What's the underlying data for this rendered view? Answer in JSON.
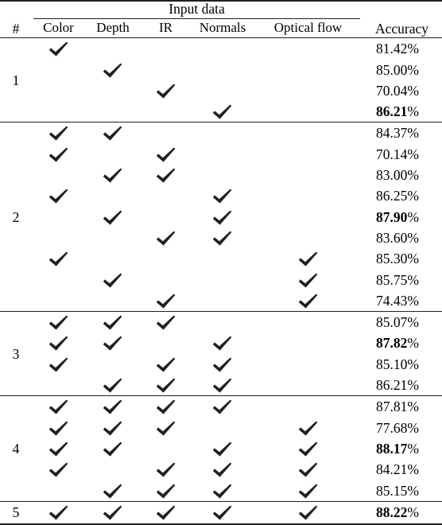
{
  "table": {
    "columns": {
      "number_header": "#",
      "group_header": "Input data",
      "accuracy_header": "Accuracy",
      "inputs": [
        "Color",
        "Depth",
        "IR",
        "Normals",
        "Optical flow"
      ]
    },
    "check_icon": "checkmark-icon",
    "percent_symbol": "%",
    "groups": [
      {
        "number": "1",
        "rows": [
          {
            "checks": [
              true,
              false,
              false,
              false,
              false
            ],
            "accuracy": "81.42",
            "bold": false
          },
          {
            "checks": [
              false,
              true,
              false,
              false,
              false
            ],
            "accuracy": "85.00",
            "bold": false
          },
          {
            "checks": [
              false,
              false,
              true,
              false,
              false
            ],
            "accuracy": "70.04",
            "bold": false
          },
          {
            "checks": [
              false,
              false,
              false,
              true,
              false
            ],
            "accuracy": "86.21",
            "bold": true
          }
        ]
      },
      {
        "number": "2",
        "rows": [
          {
            "checks": [
              true,
              true,
              false,
              false,
              false
            ],
            "accuracy": "84.37",
            "bold": false
          },
          {
            "checks": [
              true,
              false,
              true,
              false,
              false
            ],
            "accuracy": "70.14",
            "bold": false
          },
          {
            "checks": [
              false,
              true,
              true,
              false,
              false
            ],
            "accuracy": "83.00",
            "bold": false
          },
          {
            "checks": [
              true,
              false,
              false,
              true,
              false
            ],
            "accuracy": "86.25",
            "bold": false
          },
          {
            "checks": [
              false,
              true,
              false,
              true,
              false
            ],
            "accuracy": "87.90",
            "bold": true
          },
          {
            "checks": [
              false,
              false,
              true,
              true,
              false
            ],
            "accuracy": "83.60",
            "bold": false
          },
          {
            "checks": [
              true,
              false,
              false,
              false,
              true
            ],
            "accuracy": "85.30",
            "bold": false
          },
          {
            "checks": [
              false,
              true,
              false,
              false,
              true
            ],
            "accuracy": "85.75",
            "bold": false
          },
          {
            "checks": [
              false,
              false,
              true,
              false,
              true
            ],
            "accuracy": "74.43",
            "bold": false
          }
        ]
      },
      {
        "number": "3",
        "rows": [
          {
            "checks": [
              true,
              true,
              true,
              false,
              false
            ],
            "accuracy": "85.07",
            "bold": false
          },
          {
            "checks": [
              true,
              true,
              false,
              true,
              false
            ],
            "accuracy": "87.82",
            "bold": true
          },
          {
            "checks": [
              true,
              false,
              true,
              true,
              false
            ],
            "accuracy": "85.10",
            "bold": false
          },
          {
            "checks": [
              false,
              true,
              true,
              true,
              false
            ],
            "accuracy": "86.21",
            "bold": false
          }
        ]
      },
      {
        "number": "4",
        "rows": [
          {
            "checks": [
              true,
              true,
              true,
              true,
              false
            ],
            "accuracy": "87.81",
            "bold": false
          },
          {
            "checks": [
              true,
              true,
              true,
              false,
              true
            ],
            "accuracy": "77.68",
            "bold": false
          },
          {
            "checks": [
              true,
              true,
              false,
              true,
              true
            ],
            "accuracy": "88.17",
            "bold": true
          },
          {
            "checks": [
              true,
              false,
              true,
              true,
              true
            ],
            "accuracy": "84.21",
            "bold": false
          },
          {
            "checks": [
              false,
              true,
              true,
              true,
              true
            ],
            "accuracy": "85.15",
            "bold": false
          }
        ]
      },
      {
        "number": "5",
        "rows": [
          {
            "checks": [
              true,
              true,
              true,
              true,
              true
            ],
            "accuracy": "88.22",
            "bold": true
          }
        ]
      }
    ]
  }
}
